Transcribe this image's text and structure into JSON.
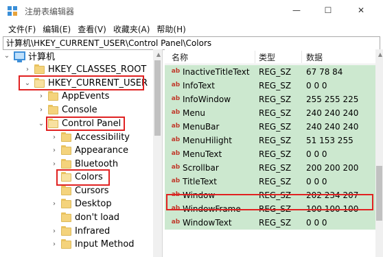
{
  "window": {
    "title": "注册表编辑器",
    "min_glyph": "—",
    "max_glyph": "☐",
    "close_glyph": "✕"
  },
  "menu": [
    "文件(F)",
    "编辑(E)",
    "查看(V)",
    "收藏夹(A)",
    "帮助(H)"
  ],
  "address": "计算机\\HKEY_CURRENT_USER\\Control Panel\\Colors",
  "tree": {
    "root": "计算机",
    "nodes": [
      {
        "label": "HKEY_CLASSES_ROOT",
        "arrow": "›"
      },
      {
        "label": "HKEY_CURRENT_USER",
        "arrow": "⌄"
      },
      {
        "label": "AppEvents",
        "arrow": "›"
      },
      {
        "label": "Console",
        "arrow": "›"
      },
      {
        "label": "Control Panel",
        "arrow": "⌄"
      },
      {
        "label": "Accessibility",
        "arrow": "›"
      },
      {
        "label": "Appearance",
        "arrow": "›"
      },
      {
        "label": "Bluetooth",
        "arrow": "›"
      },
      {
        "label": "Colors",
        "arrow": ""
      },
      {
        "label": "Cursors",
        "arrow": ""
      },
      {
        "label": "Desktop",
        "arrow": "›"
      },
      {
        "label": "don't load",
        "arrow": ""
      },
      {
        "label": "Infrared",
        "arrow": "›"
      },
      {
        "label": "Input Method",
        "arrow": "›"
      }
    ]
  },
  "list": {
    "headers": {
      "name": "名称",
      "type": "类型",
      "data": "数据"
    },
    "rows": [
      {
        "name": "InactiveTitleText",
        "type": "REG_SZ",
        "data": "67 78 84"
      },
      {
        "name": "InfoText",
        "type": "REG_SZ",
        "data": "0 0 0"
      },
      {
        "name": "InfoWindow",
        "type": "REG_SZ",
        "data": "255 255 225"
      },
      {
        "name": "Menu",
        "type": "REG_SZ",
        "data": "240 240 240"
      },
      {
        "name": "MenuBar",
        "type": "REG_SZ",
        "data": "240 240 240"
      },
      {
        "name": "MenuHilight",
        "type": "REG_SZ",
        "data": "51 153 255"
      },
      {
        "name": "MenuText",
        "type": "REG_SZ",
        "data": "0 0 0"
      },
      {
        "name": "Scrollbar",
        "type": "REG_SZ",
        "data": "200 200 200"
      },
      {
        "name": "TitleText",
        "type": "REG_SZ",
        "data": "0 0 0"
      },
      {
        "name": "Window",
        "type": "REG_SZ",
        "data": "202 234 207"
      },
      {
        "name": "WindowFrame",
        "type": "REG_SZ",
        "data": "100 100 100"
      },
      {
        "name": "WindowText",
        "type": "REG_SZ",
        "data": "0 0 0"
      }
    ]
  },
  "colors": {
    "row_bg": "#cce8cf",
    "highlight": "#e02020",
    "reg_icon": "#c0392b"
  },
  "icons": {
    "reg_value": "ab"
  }
}
